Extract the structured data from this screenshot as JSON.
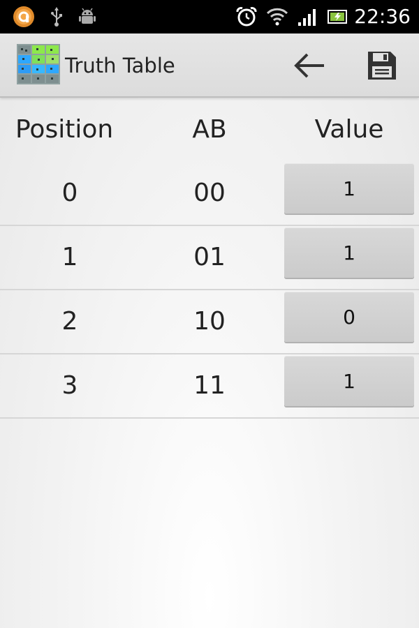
{
  "status_bar": {
    "time": "22:36",
    "icons": [
      "notification-app-icon",
      "usb-icon",
      "android-debug-icon",
      "alarm-clock-icon",
      "wifi-icon",
      "cell-signal-icon",
      "battery-charging-icon"
    ]
  },
  "action_bar": {
    "title": "Truth Table",
    "app_icon": "truth-table-app-icon",
    "actions": [
      "back-arrow-icon",
      "save-icon"
    ]
  },
  "table": {
    "headers": {
      "position": "Position",
      "inputs": "AB",
      "value": "Value"
    },
    "rows": [
      {
        "position": "0",
        "inputs": "00",
        "value": "1"
      },
      {
        "position": "1",
        "inputs": "01",
        "value": "1"
      },
      {
        "position": "2",
        "inputs": "10",
        "value": "0"
      },
      {
        "position": "3",
        "inputs": "11",
        "value": "1"
      }
    ]
  },
  "colors": {
    "status_bar_bg": "#000000",
    "action_bar_bg": "#e0e0e0",
    "value_button_bg": "#d0d0d0",
    "text": "#222222"
  }
}
